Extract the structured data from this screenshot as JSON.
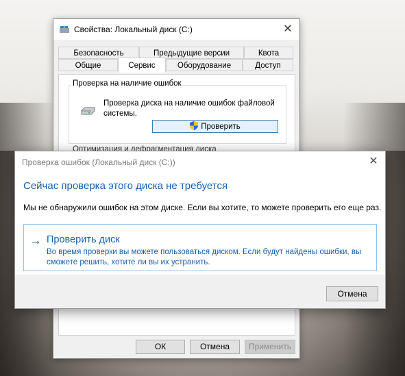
{
  "properties_window": {
    "title": "Свойства: Локальный диск (C:)",
    "tabs_row1": [
      "Безопасность",
      "Предыдущие версии",
      "Квота"
    ],
    "tabs_row2": [
      "Общие",
      "Сервис",
      "Оборудование",
      "Доступ"
    ],
    "active_tab": "Сервис",
    "error_check_group": {
      "label": "Проверка на наличие ошибок",
      "description": "Проверка диска на наличие ошибок файловой системы.",
      "button_label": "Проверить"
    },
    "partial_group_label": "Оптимизация и дефрагментация диска",
    "ok_label": "ОК",
    "cancel_label": "Отмена",
    "apply_label": "Применить"
  },
  "check_dialog": {
    "title": "Проверка ошибок (Локальный диск (C:))",
    "heading": "Сейчас проверка этого диска не требуется",
    "message": "Мы не обнаружили ошибок на этом диске. Если вы хотите, то можете проверить его еще раз.",
    "command_title": "Проверить диск",
    "command_description": "Во время проверки вы можете пользоваться диском. Если будут найдены ошибки, вы сможете решить, хотите ли вы их устранить.",
    "cancel_label": "Отмена"
  },
  "icons": {
    "window_icon": "windows-drive-icon",
    "drive_icon": "hard-drive-icon",
    "uac_icon": "uac-shield-icon",
    "close_icon": "close-icon",
    "arrow_icon": "right-arrow-icon"
  },
  "colors": {
    "accent": "#1a5fa8",
    "command_border": "#8fc3ec",
    "selected_button_bg": "#e5f1fb"
  }
}
